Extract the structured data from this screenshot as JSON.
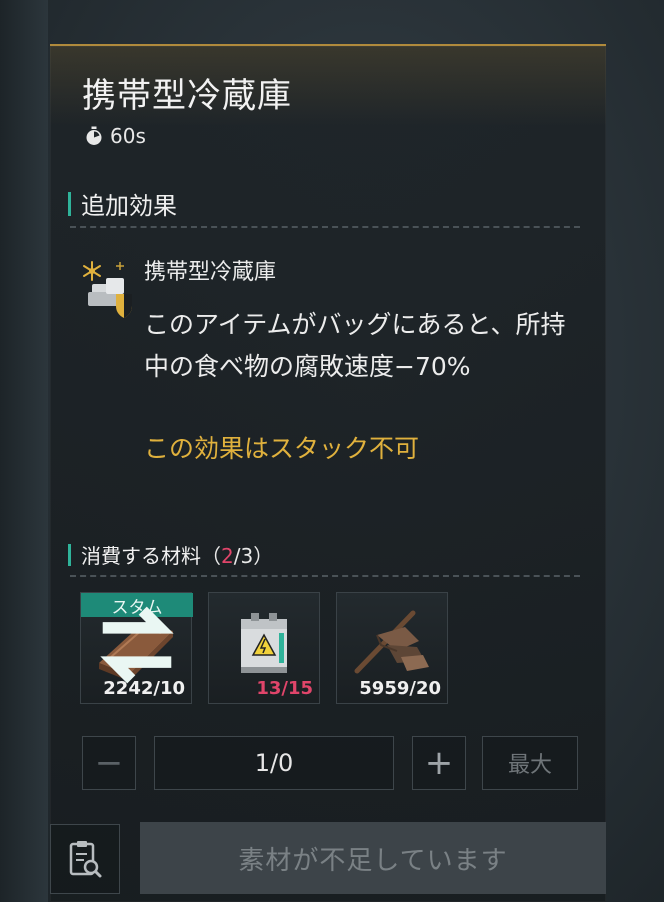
{
  "item": {
    "title": "携帯型冷蔵庫",
    "craft_time": "60s"
  },
  "effects": {
    "heading": "追加効果",
    "name": "携帯型冷蔵庫",
    "description": "このアイテムがバッグにあると、所持中の食べ物の腐敗速度−70%",
    "warning": "この効果はスタック不可"
  },
  "materials": {
    "heading": "消費する材料",
    "count_open": "（",
    "count_have": "2",
    "count_sep": "/3）",
    "items": [
      {
        "name": "copper-bar",
        "tag": "スタム",
        "qty": "2242/10",
        "sufficient": true
      },
      {
        "name": "battery-pack",
        "tag": "",
        "qty": "13/15",
        "sufficient": false
      },
      {
        "name": "scrap-wood",
        "tag": "",
        "qty": "5959/20",
        "sufficient": true
      }
    ]
  },
  "quantity": {
    "minus": "−",
    "value": "1/0",
    "plus": "+",
    "max": "最大"
  },
  "craft_button": "素材が不足しています",
  "colors": {
    "accent_teal": "#2fb39a",
    "warning_yellow": "#e0b13d",
    "shortage_pink": "#e0456a",
    "gold_border": "#b08a3c"
  },
  "icons": {
    "timer": "stopwatch-icon",
    "swap": "swap-icon",
    "recipe": "clipboard-search-icon"
  }
}
